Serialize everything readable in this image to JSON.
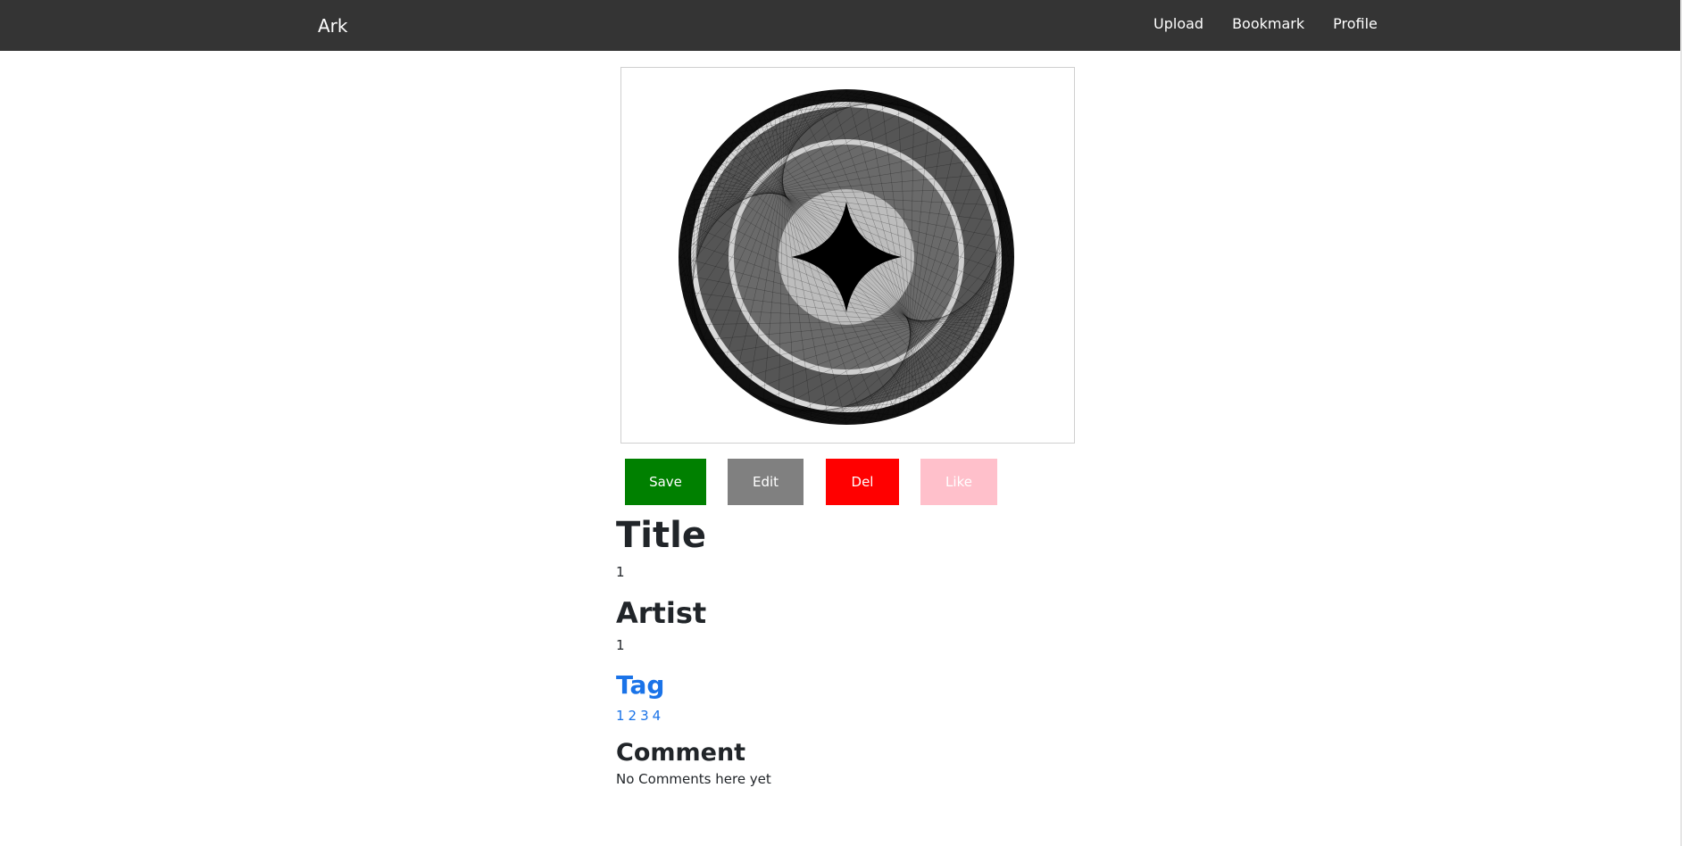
{
  "nav": {
    "brand": "Ark",
    "links": [
      "Upload",
      "Bookmark",
      "Profile"
    ]
  },
  "artwork": {
    "description_icon": "circular-pattern-artwork"
  },
  "actions": {
    "save": "Save",
    "edit": "Edit",
    "del": "Del",
    "like": "Like"
  },
  "details": {
    "title_heading": "Title",
    "title_value": "1",
    "artist_heading": "Artist",
    "artist_value": "1",
    "tag_heading": "Tag",
    "tags": [
      "1",
      "2",
      "3",
      "4"
    ],
    "comment_heading": "Comment",
    "comment_value": "No Comments here yet"
  },
  "colors": {
    "navbar": "#343434",
    "save": "#008000",
    "edit": "#808080",
    "del": "#ff0000",
    "like": "#ffc0cb",
    "link": "#1a73e8"
  }
}
